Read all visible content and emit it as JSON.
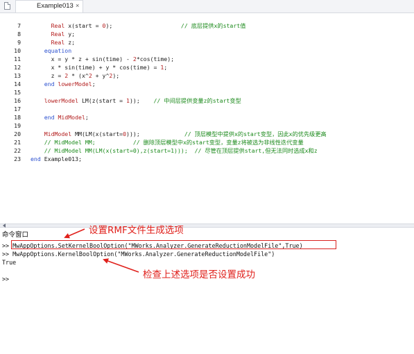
{
  "tab": {
    "title": "Example013",
    "close": "×"
  },
  "editor": {
    "lines": [
      {
        "n": "7",
        "segs": [
          {
            "c": "t-type",
            "t": "      Real "
          },
          {
            "c": "t-plain",
            "t": "x(start = "
          },
          {
            "c": "t-num",
            "t": "0"
          },
          {
            "c": "t-plain",
            "t": ");                    "
          },
          {
            "c": "t-cmt",
            "t": "// 底层提供x的start值"
          }
        ]
      },
      {
        "n": "8",
        "segs": [
          {
            "c": "t-type",
            "t": "      Real "
          },
          {
            "c": "t-plain",
            "t": "y;"
          }
        ]
      },
      {
        "n": "9",
        "segs": [
          {
            "c": "t-type",
            "t": "      Real "
          },
          {
            "c": "t-plain",
            "t": "z;"
          }
        ]
      },
      {
        "n": "10",
        "segs": [
          {
            "c": "t-kw",
            "t": "    equation"
          }
        ]
      },
      {
        "n": "11",
        "segs": [
          {
            "c": "t-plain",
            "t": "      x = y * z + sin(time) - "
          },
          {
            "c": "t-num",
            "t": "2"
          },
          {
            "c": "t-plain",
            "t": "*cos(time);"
          }
        ]
      },
      {
        "n": "12",
        "segs": [
          {
            "c": "t-plain",
            "t": "      x * sin(time) + y * cos(time) = "
          },
          {
            "c": "t-num",
            "t": "1"
          },
          {
            "c": "t-plain",
            "t": ";"
          }
        ]
      },
      {
        "n": "13",
        "segs": [
          {
            "c": "t-plain",
            "t": "      z = "
          },
          {
            "c": "t-num",
            "t": "2"
          },
          {
            "c": "t-plain",
            "t": " * (x^"
          },
          {
            "c": "t-num",
            "t": "2"
          },
          {
            "c": "t-plain",
            "t": " + y^"
          },
          {
            "c": "t-num",
            "t": "2"
          },
          {
            "c": "t-plain",
            "t": ");"
          }
        ]
      },
      {
        "n": "14",
        "segs": [
          {
            "c": "t-kw",
            "t": "    end "
          },
          {
            "c": "t-type",
            "t": "lowerModel"
          },
          {
            "c": "t-plain",
            "t": ";"
          }
        ]
      },
      {
        "n": "15",
        "segs": []
      },
      {
        "n": "16",
        "segs": [
          {
            "c": "t-type",
            "t": "    lowerModel "
          },
          {
            "c": "t-plain",
            "t": "LM(z(start = "
          },
          {
            "c": "t-num",
            "t": "1"
          },
          {
            "c": "t-plain",
            "t": "));    "
          },
          {
            "c": "t-cmt",
            "t": "// 中间层提供变量z的start变型"
          }
        ]
      },
      {
        "n": "17",
        "segs": []
      },
      {
        "n": "18",
        "segs": [
          {
            "c": "t-kw",
            "t": "    end "
          },
          {
            "c": "t-type",
            "t": "MidModel"
          },
          {
            "c": "t-plain",
            "t": ";"
          }
        ]
      },
      {
        "n": "19",
        "segs": []
      },
      {
        "n": "20",
        "segs": [
          {
            "c": "t-type",
            "t": "    MidModel "
          },
          {
            "c": "t-plain",
            "t": "MM(LM(x(start="
          },
          {
            "c": "t-num",
            "t": "0"
          },
          {
            "c": "t-plain",
            "t": ")));             "
          },
          {
            "c": "t-cmt",
            "t": "// 顶层模型中提供x的start变型，因此x的优先级更高"
          }
        ]
      },
      {
        "n": "21",
        "segs": [
          {
            "c": "t-cmt",
            "t": "    // MidModel MM;           // 删除顶层模型中x的start变型，变量z将被选为非线性迭代变量"
          }
        ]
      },
      {
        "n": "22",
        "segs": [
          {
            "c": "t-cmt",
            "t": "    // MidModel MM(LM(x(start=0),z(start=1)));  // 尽管在顶层提供start,但无法同时选成x和z"
          }
        ]
      },
      {
        "n": "23",
        "segs": [
          {
            "c": "t-kw",
            "t": "end "
          },
          {
            "c": "t-plain",
            "t": "Example013;"
          }
        ]
      }
    ]
  },
  "command_window": {
    "title": "命令窗口",
    "lines": [
      ">> MwAppOptions.SetKernelBoolOption(\"MWorks.Analyzer.GenerateReductionModelFile\",True)",
      ">> MwAppOptions.KernelBoolOption(\"MWorks.Analyzer.GenerateReductionModelFile\")",
      "True",
      "",
      ">>"
    ]
  },
  "annotations": {
    "top": "设置RMF文件生成选项",
    "bottom": "检查上述选项是否设置成功",
    "color": "#e0201b"
  },
  "colors": {
    "keyword": "#2a4fcf",
    "type": "#b31d1d",
    "comment": "#1b8a1b",
    "highlight_box": "#d9211e"
  }
}
